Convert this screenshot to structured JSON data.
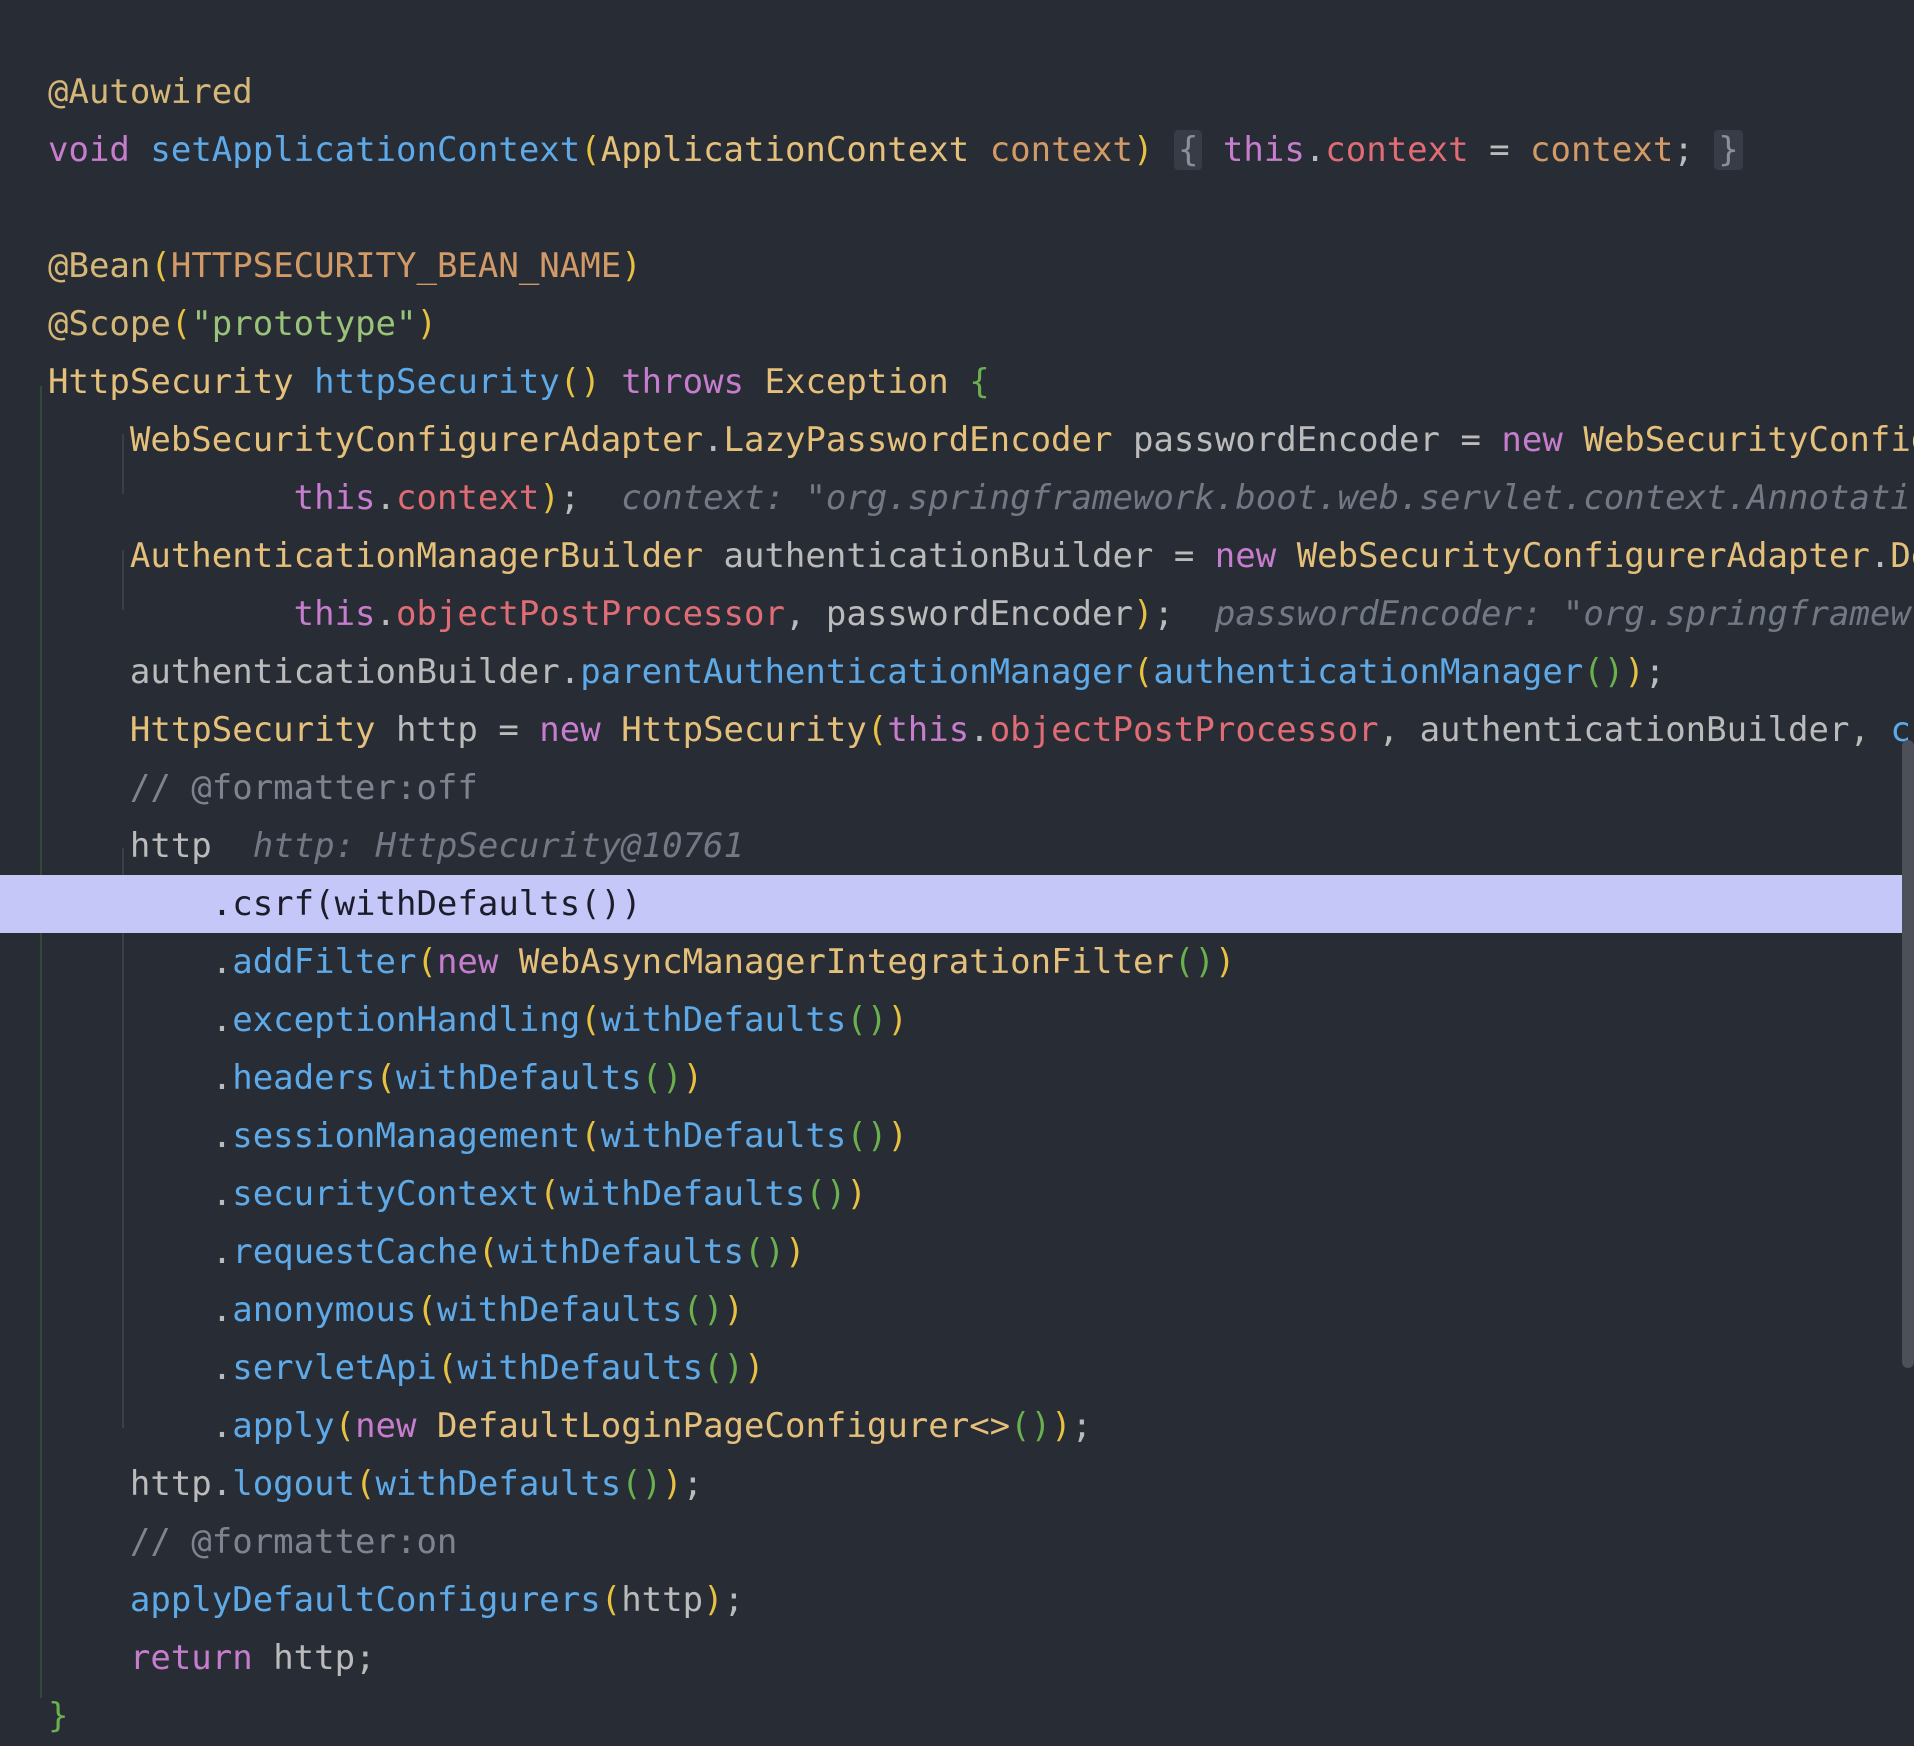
{
  "editor": {
    "background": "#282c34",
    "exec_line_color": "#c6c7f9",
    "lines": [
      {
        "tokens": []
      },
      {
        "tokens": [
          {
            "c": "ann",
            "t": "@Autowired"
          }
        ]
      },
      {
        "tokens": [
          {
            "c": "kw",
            "t": "void"
          },
          {
            "c": "id",
            "t": " "
          },
          {
            "c": "fn",
            "t": "setApplicationContext"
          },
          {
            "c": "p1",
            "t": "("
          },
          {
            "c": "ty",
            "t": "ApplicationContext"
          },
          {
            "c": "id",
            "t": " "
          },
          {
            "c": "par",
            "t": "context"
          },
          {
            "c": "p1",
            "t": ")"
          },
          {
            "c": "id",
            "t": " "
          },
          {
            "c": "foldbox",
            "t": "{"
          },
          {
            "c": "id",
            "t": " "
          },
          {
            "c": "kw",
            "t": "this"
          },
          {
            "c": "id",
            "t": "."
          },
          {
            "c": "fld",
            "t": "context"
          },
          {
            "c": "id",
            "t": " = "
          },
          {
            "c": "par",
            "t": "context"
          },
          {
            "c": "id",
            "t": "; "
          },
          {
            "c": "foldbox",
            "t": "}"
          }
        ]
      },
      {
        "tokens": []
      },
      {
        "tokens": [
          {
            "c": "ann",
            "t": "@Bean"
          },
          {
            "c": "p1",
            "t": "("
          },
          {
            "c": "par",
            "t": "HTTPSECURITY_BEAN_NAME"
          },
          {
            "c": "p1",
            "t": ")"
          }
        ]
      },
      {
        "tokens": [
          {
            "c": "ann",
            "t": "@Scope"
          },
          {
            "c": "p1",
            "t": "("
          },
          {
            "c": "str",
            "t": "\"prototype\""
          },
          {
            "c": "p1",
            "t": ")"
          }
        ]
      },
      {
        "tokens": [
          {
            "c": "ty",
            "t": "HttpSecurity"
          },
          {
            "c": "id",
            "t": " "
          },
          {
            "c": "fn",
            "t": "httpSecurity"
          },
          {
            "c": "p1",
            "t": "()"
          },
          {
            "c": "id",
            "t": " "
          },
          {
            "c": "kw",
            "t": "throws"
          },
          {
            "c": "id",
            "t": " "
          },
          {
            "c": "ty",
            "t": "Exception"
          },
          {
            "c": "id",
            "t": " "
          },
          {
            "c": "p2",
            "t": "{"
          }
        ]
      },
      {
        "tokens": [
          {
            "c": "id",
            "t": "    "
          },
          {
            "c": "ty",
            "t": "WebSecurityConfigurerAdapter"
          },
          {
            "c": "id",
            "t": "."
          },
          {
            "c": "ty",
            "t": "LazyPasswordEncoder"
          },
          {
            "c": "id",
            "t": " passwordEncoder = "
          },
          {
            "c": "kw",
            "t": "new"
          },
          {
            "c": "id",
            "t": " "
          },
          {
            "c": "ty",
            "t": "WebSecurityConfig"
          }
        ]
      },
      {
        "tokens": [
          {
            "c": "id",
            "t": "            "
          },
          {
            "c": "kw",
            "t": "this"
          },
          {
            "c": "id",
            "t": "."
          },
          {
            "c": "fld",
            "t": "context"
          },
          {
            "c": "p1",
            "t": ")"
          },
          {
            "c": "id",
            "t": ";  "
          },
          {
            "c": "hint",
            "t": "context: \"org.springframework.boot.web.servlet.context.Annotati"
          }
        ]
      },
      {
        "tokens": [
          {
            "c": "id",
            "t": "    "
          },
          {
            "c": "ty",
            "t": "AuthenticationManagerBuilder"
          },
          {
            "c": "id",
            "t": " authenticationBuilder = "
          },
          {
            "c": "kw",
            "t": "new"
          },
          {
            "c": "id",
            "t": " "
          },
          {
            "c": "ty",
            "t": "WebSecurityConfigurerAdapter"
          },
          {
            "c": "id",
            "t": "."
          },
          {
            "c": "ty",
            "t": "De"
          }
        ]
      },
      {
        "tokens": [
          {
            "c": "id",
            "t": "            "
          },
          {
            "c": "kw",
            "t": "this"
          },
          {
            "c": "id",
            "t": "."
          },
          {
            "c": "fld",
            "t": "objectPostProcessor"
          },
          {
            "c": "id",
            "t": ", passwordEncoder"
          },
          {
            "c": "p1",
            "t": ")"
          },
          {
            "c": "id",
            "t": ";  "
          },
          {
            "c": "hint",
            "t": "passwordEncoder: \"org.springframew"
          }
        ]
      },
      {
        "tokens": [
          {
            "c": "id",
            "t": "    authenticationBuilder."
          },
          {
            "c": "fn",
            "t": "parentAuthenticationManager"
          },
          {
            "c": "p1",
            "t": "("
          },
          {
            "c": "fn",
            "t": "authenticationManager"
          },
          {
            "c": "p2",
            "t": "()"
          },
          {
            "c": "p1",
            "t": ")"
          },
          {
            "c": "id",
            "t": ";"
          }
        ]
      },
      {
        "tokens": [
          {
            "c": "id",
            "t": "    "
          },
          {
            "c": "ty",
            "t": "HttpSecurity"
          },
          {
            "c": "id",
            "t": " http = "
          },
          {
            "c": "kw",
            "t": "new"
          },
          {
            "c": "id",
            "t": " "
          },
          {
            "c": "ty",
            "t": "HttpSecurity"
          },
          {
            "c": "p1",
            "t": "("
          },
          {
            "c": "kw",
            "t": "this"
          },
          {
            "c": "id",
            "t": "."
          },
          {
            "c": "fld",
            "t": "objectPostProcessor"
          },
          {
            "c": "id",
            "t": ", authenticationBuilder, "
          },
          {
            "c": "fn",
            "t": "cr"
          }
        ]
      },
      {
        "tokens": [
          {
            "c": "id",
            "t": "    "
          },
          {
            "c": "cmt",
            "t": "// @formatter:off"
          }
        ]
      },
      {
        "tokens": [
          {
            "c": "id",
            "t": "    http  "
          },
          {
            "c": "hint",
            "t": "http: HttpSecurity@10761"
          }
        ]
      },
      {
        "exec": true,
        "tokens": [
          {
            "c": "id",
            "t": "        .csrf(withDefaults())"
          }
        ]
      },
      {
        "tokens": [
          {
            "c": "id",
            "t": "        ."
          },
          {
            "c": "fn",
            "t": "addFilter"
          },
          {
            "c": "p1",
            "t": "("
          },
          {
            "c": "kw",
            "t": "new"
          },
          {
            "c": "id",
            "t": " "
          },
          {
            "c": "ty",
            "t": "WebAsyncManagerIntegrationFilter"
          },
          {
            "c": "p2",
            "t": "()"
          },
          {
            "c": "p1",
            "t": ")"
          }
        ]
      },
      {
        "tokens": [
          {
            "c": "id",
            "t": "        ."
          },
          {
            "c": "fn",
            "t": "exceptionHandling"
          },
          {
            "c": "p1",
            "t": "("
          },
          {
            "c": "fn",
            "t": "withDefaults"
          },
          {
            "c": "p2",
            "t": "()"
          },
          {
            "c": "p1",
            "t": ")"
          }
        ]
      },
      {
        "tokens": [
          {
            "c": "id",
            "t": "        ."
          },
          {
            "c": "fn",
            "t": "headers"
          },
          {
            "c": "p1",
            "t": "("
          },
          {
            "c": "fn",
            "t": "withDefaults"
          },
          {
            "c": "p2",
            "t": "()"
          },
          {
            "c": "p1",
            "t": ")"
          }
        ]
      },
      {
        "tokens": [
          {
            "c": "id",
            "t": "        ."
          },
          {
            "c": "fn",
            "t": "sessionManagement"
          },
          {
            "c": "p1",
            "t": "("
          },
          {
            "c": "fn",
            "t": "withDefaults"
          },
          {
            "c": "p2",
            "t": "()"
          },
          {
            "c": "p1",
            "t": ")"
          }
        ]
      },
      {
        "tokens": [
          {
            "c": "id",
            "t": "        ."
          },
          {
            "c": "fn",
            "t": "securityContext"
          },
          {
            "c": "p1",
            "t": "("
          },
          {
            "c": "fn",
            "t": "withDefaults"
          },
          {
            "c": "p2",
            "t": "()"
          },
          {
            "c": "p1",
            "t": ")"
          }
        ]
      },
      {
        "tokens": [
          {
            "c": "id",
            "t": "        ."
          },
          {
            "c": "fn",
            "t": "requestCache"
          },
          {
            "c": "p1",
            "t": "("
          },
          {
            "c": "fn",
            "t": "withDefaults"
          },
          {
            "c": "p2",
            "t": "()"
          },
          {
            "c": "p1",
            "t": ")"
          }
        ]
      },
      {
        "tokens": [
          {
            "c": "id",
            "t": "        ."
          },
          {
            "c": "fn",
            "t": "anonymous"
          },
          {
            "c": "p1",
            "t": "("
          },
          {
            "c": "fn",
            "t": "withDefaults"
          },
          {
            "c": "p2",
            "t": "()"
          },
          {
            "c": "p1",
            "t": ")"
          }
        ]
      },
      {
        "tokens": [
          {
            "c": "id",
            "t": "        ."
          },
          {
            "c": "fn",
            "t": "servletApi"
          },
          {
            "c": "p1",
            "t": "("
          },
          {
            "c": "fn",
            "t": "withDefaults"
          },
          {
            "c": "p2",
            "t": "()"
          },
          {
            "c": "p1",
            "t": ")"
          }
        ]
      },
      {
        "tokens": [
          {
            "c": "id",
            "t": "        ."
          },
          {
            "c": "fn",
            "t": "apply"
          },
          {
            "c": "p1",
            "t": "("
          },
          {
            "c": "kw",
            "t": "new"
          },
          {
            "c": "id",
            "t": " "
          },
          {
            "c": "ty",
            "t": "DefaultLoginPageConfigurer<>"
          },
          {
            "c": "p2",
            "t": "()"
          },
          {
            "c": "p1",
            "t": ")"
          },
          {
            "c": "id",
            "t": ";"
          }
        ]
      },
      {
        "tokens": [
          {
            "c": "id",
            "t": "    http."
          },
          {
            "c": "fn",
            "t": "logout"
          },
          {
            "c": "p1",
            "t": "("
          },
          {
            "c": "fn",
            "t": "withDefaults"
          },
          {
            "c": "p2",
            "t": "()"
          },
          {
            "c": "p1",
            "t": ")"
          },
          {
            "c": "id",
            "t": ";"
          }
        ]
      },
      {
        "tokens": [
          {
            "c": "id",
            "t": "    "
          },
          {
            "c": "cmt",
            "t": "// @formatter:on"
          }
        ]
      },
      {
        "tokens": [
          {
            "c": "id",
            "t": "    "
          },
          {
            "c": "fn",
            "t": "applyDefaultConfigurers"
          },
          {
            "c": "p1",
            "t": "("
          },
          {
            "c": "id",
            "t": "http"
          },
          {
            "c": "p1",
            "t": ")"
          },
          {
            "c": "id",
            "t": ";"
          }
        ]
      },
      {
        "tokens": [
          {
            "c": "id",
            "t": "    "
          },
          {
            "c": "kw",
            "t": "return"
          },
          {
            "c": "id",
            "t": " http;"
          }
        ]
      },
      {
        "tokens": [
          {
            "c": "p2",
            "t": "}"
          }
        ]
      }
    ]
  }
}
